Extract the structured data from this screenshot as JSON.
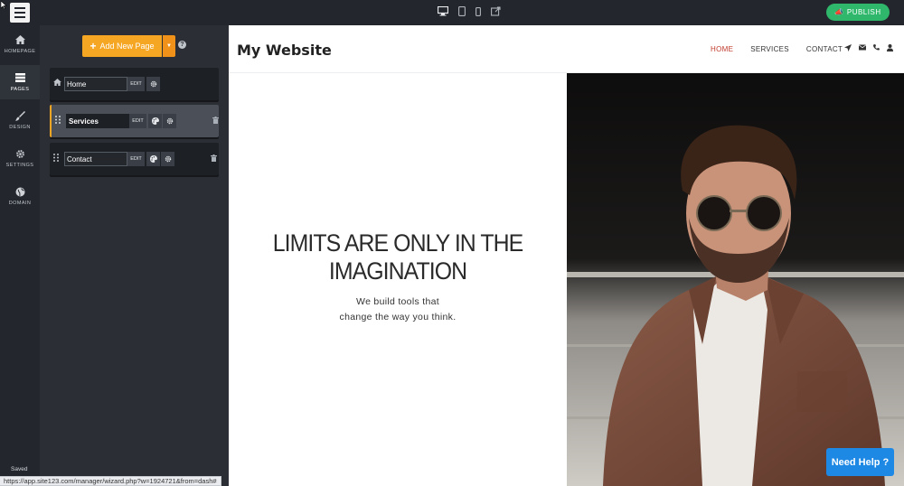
{
  "topbar": {
    "publish_label": "PUBLISH",
    "publish_icon": "megaphone-icon",
    "devices": [
      "desktop-icon",
      "tablet-icon",
      "mobile-icon",
      "external-link-icon"
    ]
  },
  "sidebar": {
    "items": [
      {
        "label": "HOMEPAGE",
        "icon": "home-icon"
      },
      {
        "label": "PAGES",
        "icon": "pages-icon"
      },
      {
        "label": "DESIGN",
        "icon": "brush-icon"
      },
      {
        "label": "SETTINGS",
        "icon": "gear-icon"
      },
      {
        "label": "DOMAIN",
        "icon": "globe-icon"
      }
    ],
    "active": "PAGES",
    "status": "Saved"
  },
  "pages_panel": {
    "add_label": "Add New Page",
    "help": "?",
    "pages": [
      {
        "name": "Home",
        "edit_label": "EDIT"
      },
      {
        "name": "Services",
        "edit_label": "EDIT"
      },
      {
        "name": "Contact",
        "edit_label": "EDIT"
      }
    ],
    "selected": "Services"
  },
  "preview": {
    "site_title": "My Website",
    "nav": [
      "HOME",
      "SERVICES",
      "CONTACT"
    ],
    "nav_active": "HOME",
    "hero_title_line1": "LIMITS ARE ONLY IN THE",
    "hero_title_line2": "IMAGINATION",
    "hero_sub_line1": "We build tools that",
    "hero_sub_line2": "change the way you think.",
    "accent_color": "#c0392b"
  },
  "help_button": "Need Help ?",
  "status_url": "https://app.site123.com/manager/wizard.php?w=1924721&from=dash#",
  "colors": {
    "orange": "#f5a623",
    "publish_green": "#2fb86b",
    "help_blue": "#1e88e5",
    "dark_bg": "#23272d"
  }
}
